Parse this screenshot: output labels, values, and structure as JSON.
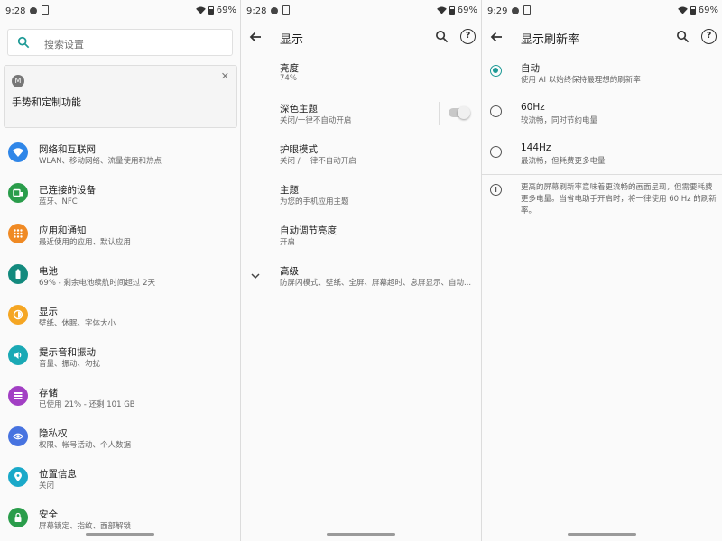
{
  "screens": [
    {
      "status": {
        "time": "9:28",
        "battery": "69%"
      },
      "search": {
        "placeholder": "搜索设置"
      },
      "card": {
        "title": "手势和定制功能",
        "logo": "M"
      },
      "items": [
        {
          "title": "网络和互联网",
          "subtitle": "WLAN、移动网络、流量使用和热点",
          "icon": "wifi-icon",
          "color": "#2f86e8"
        },
        {
          "title": "已连接的设备",
          "subtitle": "蓝牙、NFC",
          "icon": "devices-icon",
          "color": "#2a9d4b"
        },
        {
          "title": "应用和通知",
          "subtitle": "最近使用的应用、默认应用",
          "icon": "apps-icon",
          "color": "#f08a24"
        },
        {
          "title": "电池",
          "subtitle": "69% - 剩余电池续航时间超过 2天",
          "icon": "battery-icon",
          "color": "#138a7e"
        },
        {
          "title": "显示",
          "subtitle": "壁纸、休眠、字体大小",
          "icon": "brightness-icon",
          "color": "#f5a623"
        },
        {
          "title": "提示音和振动",
          "subtitle": "音量、振动、勿扰",
          "icon": "volume-icon",
          "color": "#1aa9b5"
        },
        {
          "title": "存储",
          "subtitle": "已使用 21% - 还剩 101 GB",
          "icon": "storage-icon",
          "color": "#a23fc4"
        },
        {
          "title": "隐私权",
          "subtitle": "权限、帐号活动、个人数据",
          "icon": "privacy-icon",
          "color": "#4773e0"
        },
        {
          "title": "位置信息",
          "subtitle": "关闭",
          "icon": "location-icon",
          "color": "#1aa9c9"
        },
        {
          "title": "安全",
          "subtitle": "屏幕锁定、指纹、面部解锁",
          "icon": "lock-icon",
          "color": "#2a9d4b"
        }
      ]
    },
    {
      "status": {
        "time": "9:28",
        "battery": "69%"
      },
      "title": "显示",
      "help_glyph": "?",
      "items": [
        {
          "title": "亮度",
          "subtitle": "74%"
        },
        {
          "title": "深色主题",
          "subtitle": "关闭/一律不自动开启",
          "toggle": false
        },
        {
          "title": "护眼模式",
          "subtitle": "关闭 / 一律不自动开启"
        },
        {
          "title": "主题",
          "subtitle": "为您的手机应用主题"
        },
        {
          "title": "自动调节亮度",
          "subtitle": "开启"
        },
        {
          "title": "高级",
          "subtitle": "防屏闪模式、壁纸、全屏、屏幕超时、息屏显示、自动..."
        }
      ]
    },
    {
      "status": {
        "time": "9:29",
        "battery": "69%"
      },
      "title": "显示刷新率",
      "help_glyph": "?",
      "options": [
        {
          "title": "自动",
          "subtitle": "使用 AI 以始终保持最理想的刷新率",
          "selected": true
        },
        {
          "title": "60Hz",
          "subtitle": "较流畅，同时节约电量",
          "selected": false
        },
        {
          "title": "144Hz",
          "subtitle": "最流畅，但耗费更多电量",
          "selected": false
        }
      ],
      "info_glyph": "i",
      "note": "更高的屏幕刷新率意味着更流畅的画面呈现，但需要耗费更多电量。当省电助手开启时，将一律使用 60 Hz 的刷新率。"
    }
  ],
  "accent_color": "#1e9a96"
}
